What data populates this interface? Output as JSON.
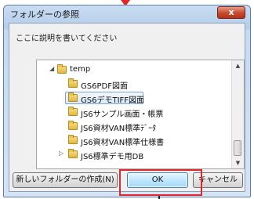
{
  "window": {
    "title": "フォルダーの参照",
    "close_label": "x"
  },
  "description": "ここに説明を書いてください",
  "tree": {
    "items": [
      {
        "label": "temp",
        "expander": "◢"
      },
      {
        "label": "GS6PDF図面"
      },
      {
        "label": "GS6デモTIFF図面",
        "selected": true
      },
      {
        "label": "JS6サンプル画面・帳票"
      },
      {
        "label": "JS6資材VAN標準ﾃﾞｰﾀ"
      },
      {
        "label": "JS6資材VAN標準仕様書"
      },
      {
        "label": "JS6標準デモ用DB",
        "expander": "▷"
      }
    ]
  },
  "buttons": {
    "new_folder": "新しいフォルダーの作成(N)",
    "ok": "OK",
    "cancel": "キャンセル"
  },
  "colors": {
    "highlight": "#e0282a",
    "selection_border": "#7da2ce",
    "close_button": "#c7492d"
  }
}
